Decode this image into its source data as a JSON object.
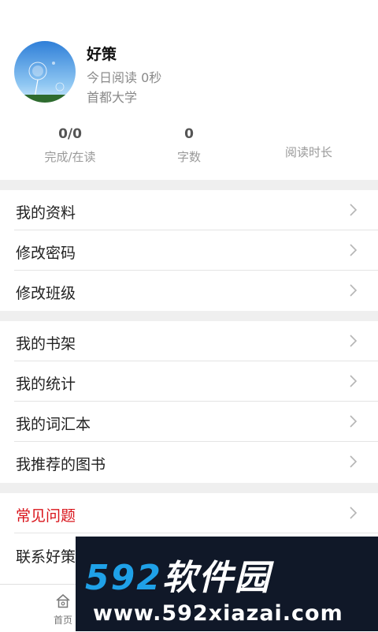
{
  "profile": {
    "name": "好策",
    "reading_today": "今日阅读 0秒",
    "school": "首都大学"
  },
  "stats": [
    {
      "value": "0/0",
      "label": "完成/在读"
    },
    {
      "value": "0",
      "label": "字数"
    },
    {
      "value": "",
      "label": "阅读时长"
    }
  ],
  "menu_group_1": [
    "我的资料",
    "修改密码",
    "修改班级"
  ],
  "menu_group_2": [
    "我的书架",
    "我的统计",
    "我的词汇本",
    "我推荐的图书"
  ],
  "menu_group_3": [
    "常见问题",
    "联系好策"
  ],
  "tabbar": {
    "home_label": "首页",
    "home_icon": "home-icon"
  },
  "watermark": {
    "logo_number": "592",
    "logo_text": "软件园",
    "url": "www.592xiazai.com"
  },
  "colors": {
    "accent_red": "#d9141b",
    "separator": "#efefef",
    "watermark_blue": "#1fa1e8"
  }
}
